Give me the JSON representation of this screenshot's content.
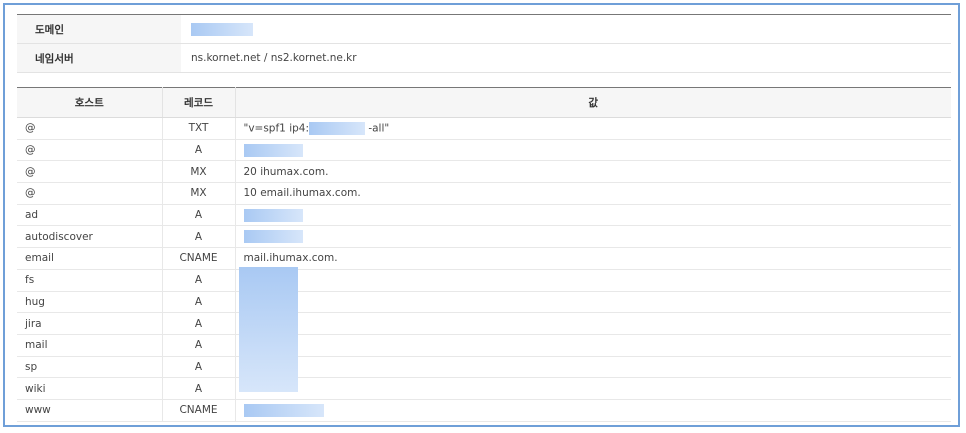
{
  "domain_row": {
    "label": "도메인"
  },
  "nameserver_row": {
    "label": "네임서버",
    "value": "ns.kornet.net / ns2.kornet.ne.kr"
  },
  "headers": {
    "host": "호스트",
    "record": "레코드",
    "value": "값"
  },
  "records": [
    {
      "host": "@",
      "type": "TXT",
      "value_pre": "\"v=spf1 ip4:",
      "value_post": " -all\""
    },
    {
      "host": "@",
      "type": "A",
      "value": ""
    },
    {
      "host": "@",
      "type": "MX",
      "value": "20 ihumax.com."
    },
    {
      "host": "@",
      "type": "MX",
      "value": "10 email.ihumax.com."
    },
    {
      "host": "ad",
      "type": "A",
      "value": ""
    },
    {
      "host": "autodiscover",
      "type": "A",
      "value": ""
    },
    {
      "host": "email",
      "type": "CNAME",
      "value": "mail.ihumax.com."
    },
    {
      "host": "fs",
      "type": "A",
      "value": ""
    },
    {
      "host": "hug",
      "type": "A",
      "value": ""
    },
    {
      "host": "jira",
      "type": "A",
      "value": ""
    },
    {
      "host": "mail",
      "type": "A",
      "value": ""
    },
    {
      "host": "sp",
      "type": "A",
      "value": ""
    },
    {
      "host": "wiki",
      "type": "A",
      "value": ""
    },
    {
      "host": "www",
      "type": "CNAME",
      "value": ""
    }
  ]
}
